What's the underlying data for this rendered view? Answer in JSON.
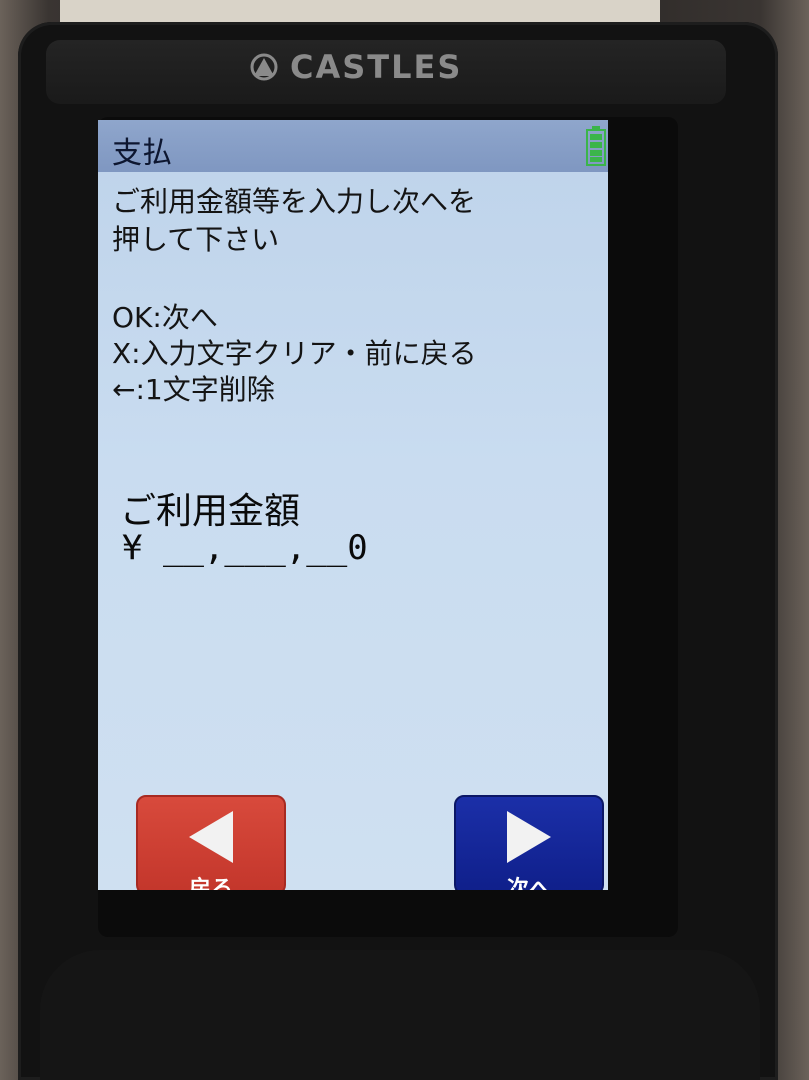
{
  "device": {
    "brand": "CASTLES",
    "logo_icon": "castles-logo-icon"
  },
  "header": {
    "title": "支払",
    "battery_icon": "battery-full-icon",
    "battery_color": "#3bb54a"
  },
  "instructions": {
    "line1": "ご利用金額等を入力し次へを",
    "line2": "押して下さい"
  },
  "help": {
    "ok": "OK:次へ",
    "x": "X:入力文字クリア・前に戻る",
    "backspace": "←:1文字削除"
  },
  "amount": {
    "label": "ご利用金額",
    "currency": "¥",
    "value": "__,___,__0"
  },
  "buttons": {
    "back_label": "戻る",
    "back_color": "#c3362b",
    "next_label": "次へ",
    "next_color": "#0f1f8a"
  }
}
